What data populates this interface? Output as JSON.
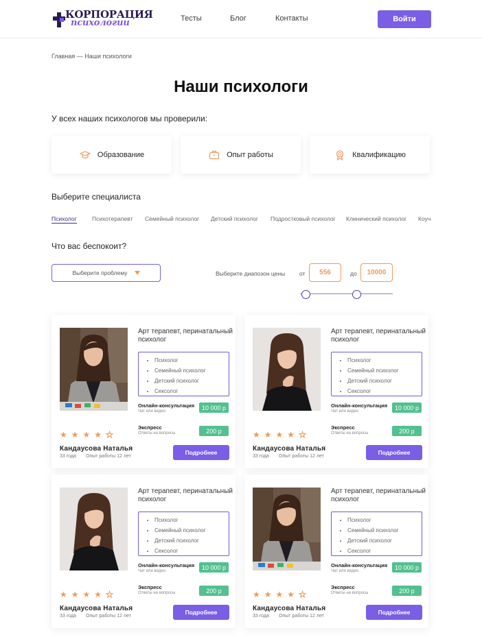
{
  "header": {
    "logo_line1": "КОРПОРАЦИЯ",
    "logo_line2": "психологии",
    "nav": [
      "Тесты",
      "Блог",
      "Контакты"
    ],
    "login_label": "Войти"
  },
  "breadcrumb": "Главная — Наши психологи",
  "page_title": "Наши психологи",
  "checked_text": "У всех наших психологов мы проверили:",
  "features": [
    {
      "label": "Образование",
      "icon": "graduation-cap-icon"
    },
    {
      "label": "Опыт работы",
      "icon": "briefcase-icon"
    },
    {
      "label": "Квалификацию",
      "icon": "certificate-icon"
    }
  ],
  "choose_specialist": "Выберите специалиста",
  "specialist_tabs": [
    "Психолог",
    "Психотерапевт",
    "Семейный психолог",
    "Детский психолог",
    "Подростковый психолог",
    "Клинический психолог",
    "Коуч"
  ],
  "problem_heading": "Что вас беспокоит?",
  "problem_select": "Выберите проблему",
  "price": {
    "label": "Выберите диапозон цены",
    "from_label": "от",
    "from_value": "556",
    "to_label": "до",
    "to_value": "10000"
  },
  "colors": {
    "accent": "#7b5ee6",
    "orange": "#ee9a5b",
    "green": "#52c08f"
  },
  "cards": [
    {
      "role": "Арт терапевт, перинатальный психолог",
      "specs": [
        "Психолог",
        "Семейный психолог",
        "Детский психолог",
        "Сексолог"
      ],
      "online_label": "Онлайн-консультация",
      "online_sub": "Чат или видео",
      "online_price": "10 000 р",
      "express_label": "Экспресс",
      "express_sub": "Ответы на вопросы",
      "express_price": "200 р",
      "rating": 4.5,
      "name": "Кандаусова Наталья",
      "age": "33 года",
      "experience": "Опыт работы 12 лет",
      "button": "Подробнее",
      "photo": "blazer"
    },
    {
      "role": "Арт терапевт, перинатальный психолог",
      "specs": [
        "Психолог",
        "Семейный психолог",
        "Детский психолог",
        "Сексолог"
      ],
      "online_label": "Онлайн-консультация",
      "online_sub": "Чат или видео",
      "online_price": "10 000 р",
      "express_label": "Экспресс",
      "express_sub": "Ответы на вопросы",
      "express_price": "200 р",
      "rating": 4.5,
      "name": "Кандаусова Наталья",
      "age": "33 года",
      "experience": "Опыт работы 12 лет",
      "button": "Подробнее",
      "photo": "portrait"
    },
    {
      "role": "Арт терапевт, перинатальный психолог",
      "specs": [
        "Психолог",
        "Семейный психолог",
        "Детский психолог",
        "Сексолог"
      ],
      "online_label": "Онлайн-консультация",
      "online_sub": "Чат или видео",
      "online_price": "10 000 р",
      "express_label": "Экспресс",
      "express_sub": "Ответы на вопросы",
      "express_price": "200 р",
      "rating": 4.5,
      "name": "Кандаусова Наталья",
      "age": "33 года",
      "experience": "Опыт работы 12 лет",
      "button": "Подробнее",
      "photo": "portrait"
    },
    {
      "role": "Арт терапевт, перинатальный психолог",
      "specs": [
        "Психолог",
        "Семейный психолог",
        "Детский психолог",
        "Сексолог"
      ],
      "online_label": "Онлайн-консультация",
      "online_sub": "Чат или видео",
      "online_price": "10 000 р",
      "express_label": "Экспресс",
      "express_sub": "Ответы на вопросы",
      "express_price": "200 р",
      "rating": 4.5,
      "name": "Кандаусова Наталья",
      "age": "33 года",
      "experience": "Опыт работы 12 лет",
      "button": "Подробнее",
      "photo": "blazer"
    }
  ]
}
